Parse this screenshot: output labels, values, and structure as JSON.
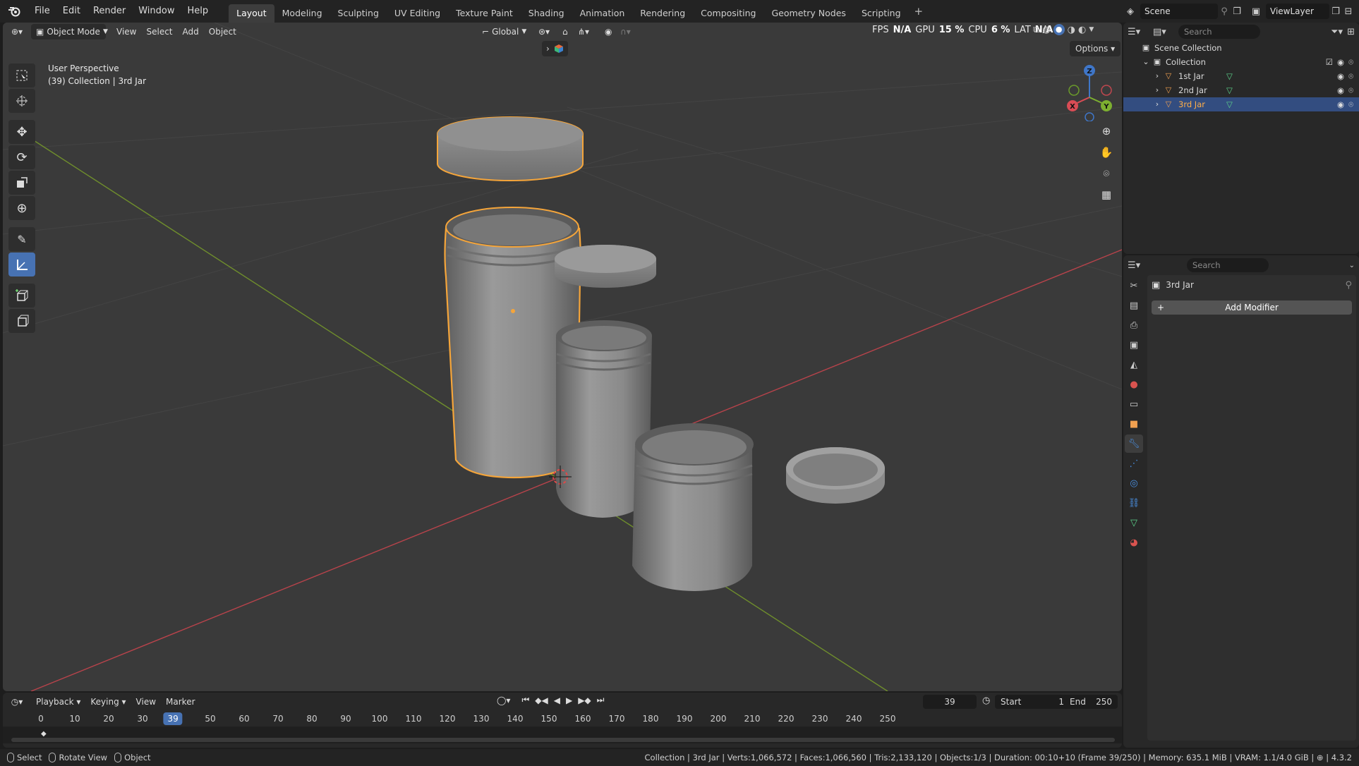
{
  "topbar": {
    "menus": [
      "File",
      "Edit",
      "Render",
      "Window",
      "Help"
    ],
    "workspaces": [
      "Layout",
      "Modeling",
      "Sculpting",
      "UV Editing",
      "Texture Paint",
      "Shading",
      "Animation",
      "Rendering",
      "Compositing",
      "Geometry Nodes",
      "Scripting"
    ],
    "active_workspace": "Layout",
    "scene": "Scene",
    "view_layer": "ViewLayer"
  },
  "viewport": {
    "mode": "Object Mode",
    "menus": [
      "View",
      "Select",
      "Add",
      "Object"
    ],
    "orientation": "Global",
    "options": "Options",
    "overlay_title": "User Perspective",
    "overlay_subtitle": "(39) Collection | 3rd Jar",
    "stats": {
      "fps_label": "FPS",
      "fps_value": "N/A",
      "gpu_label": "GPU",
      "gpu_value": "15 %",
      "cpu_label": "CPU",
      "cpu_value": "6 %",
      "lat_label": "LAT",
      "lat_value": "N/A"
    },
    "gizmo_axes": [
      "X",
      "Y",
      "Z"
    ]
  },
  "outliner": {
    "search_placeholder": "Search",
    "scene_collection": "Scene Collection",
    "collection": "Collection",
    "objects": [
      "1st Jar",
      "2nd Jar",
      "3rd Jar"
    ],
    "selected_object": "3rd Jar"
  },
  "properties": {
    "search_placeholder": "Search",
    "object_name": "3rd Jar",
    "add_modifier": "Add Modifier"
  },
  "timeline": {
    "menus": [
      "Playback",
      "Keying",
      "View",
      "Marker"
    ],
    "current_frame": "39",
    "start_label": "Start",
    "start_value": "1",
    "end_label": "End",
    "end_value": "250",
    "ticks": [
      "0",
      "10",
      "20",
      "30",
      "50",
      "60",
      "70",
      "80",
      "90",
      "100",
      "110",
      "120",
      "130",
      "140",
      "150",
      "160",
      "170",
      "180",
      "190",
      "200",
      "210",
      "220",
      "230",
      "240",
      "250"
    ],
    "tick_values": [
      0,
      10,
      20,
      30,
      50,
      60,
      70,
      80,
      90,
      100,
      110,
      120,
      130,
      140,
      150,
      160,
      170,
      180,
      190,
      200,
      210,
      220,
      230,
      240,
      250
    ],
    "cursor_frame": 39
  },
  "statusbar": {
    "select": "Select",
    "rotate_view": "Rotate View",
    "object": "Object",
    "info": "Collection | 3rd Jar | Verts:1,066,572 | Faces:1,066,560 | Tris:2,133,120 | Objects:1/3 | Duration: 00:10+10 (Frame 39/250) | Memory: 635.1 MiB | VRAM: 1.1/4.0 GiB |",
    "version": "4.3.2"
  },
  "colors": {
    "selection_outline": "#f5a53a",
    "active_blue": "#4772b3",
    "x_axis": "#c8454f",
    "y_axis": "#7a9a2a"
  }
}
